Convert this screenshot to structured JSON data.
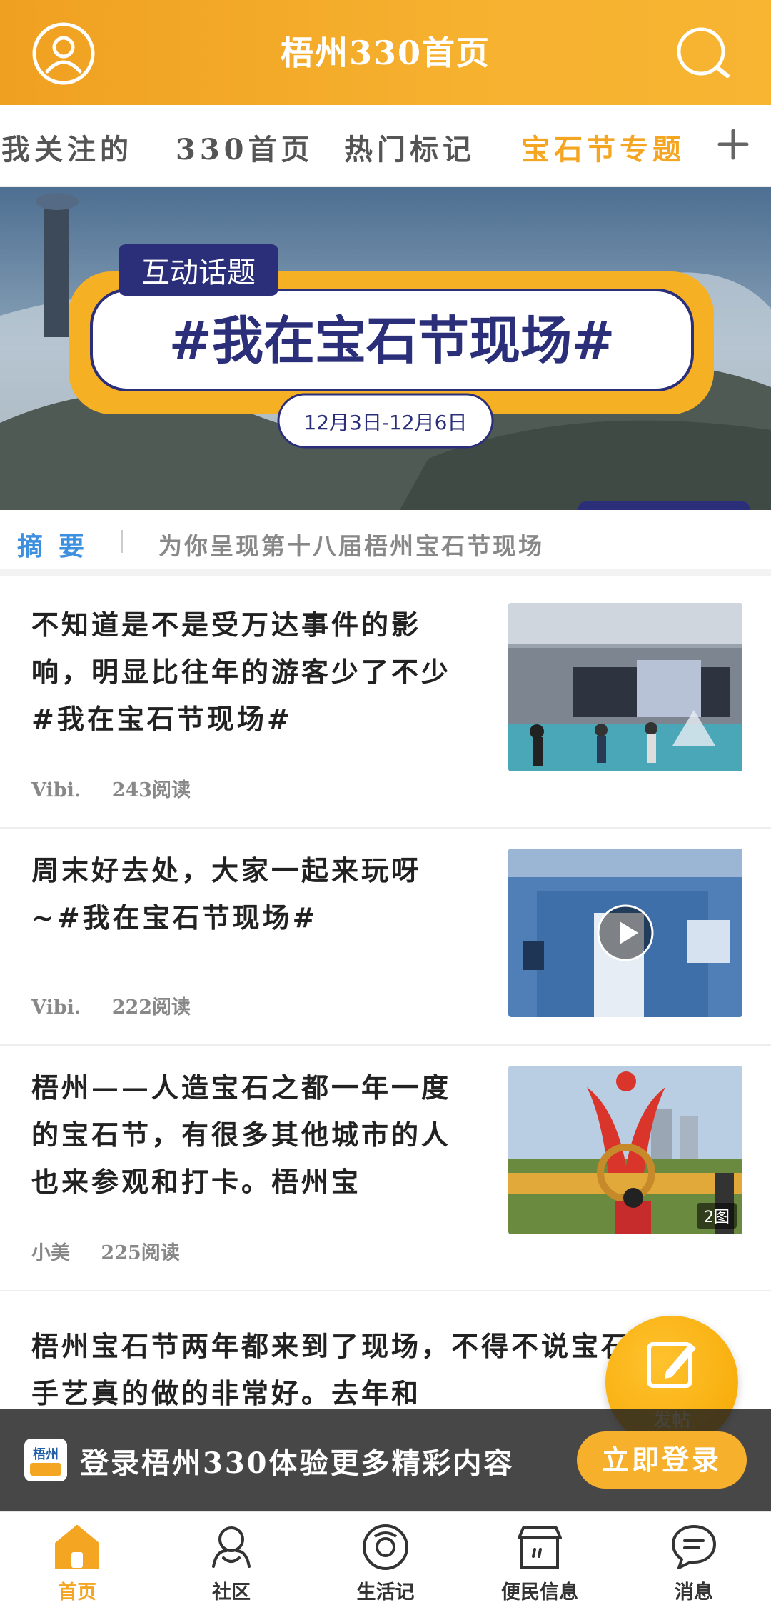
{
  "header": {
    "title": "梧州330首页"
  },
  "tabs": [
    {
      "label": "我关注的"
    },
    {
      "label": "330首页"
    },
    {
      "label": "热门标记"
    },
    {
      "label": "宝石节专题",
      "active": true
    }
  ],
  "banner": {
    "tag": "互动话题",
    "headline": "#我在宝石节现场#",
    "dates": "12月3日-12月6日"
  },
  "summary": {
    "label": "摘要",
    "text": "为你呈现第十八届梧州宝石节现场"
  },
  "feed": [
    {
      "title": "不知道是不是受万达事件的影响，明显比往年的游客少了不少#我在宝石节现场#",
      "author": "Vibi.",
      "reads": "243阅读",
      "media": "photo"
    },
    {
      "title": "周末好去处，大家一起来玩呀~#我在宝石节现场#",
      "author": "Vibi.",
      "reads": "222阅读",
      "media": "video"
    },
    {
      "title": "梧州——人造宝石之都一年一度的宝石节，有很多其他城市的人也来参观和打卡。梧州宝",
      "author": "小美",
      "reads": "225阅读",
      "media": "photo",
      "image_count": "2图"
    },
    {
      "title": "梧州宝石节两年都来到了现场，不得不说宝石文化和手艺真的做的非常好。去年和"
    }
  ],
  "fab": {
    "label": "发帖"
  },
  "login_bar": {
    "logo_text": "梧州",
    "text": "登录梧州330体验更多精彩内容",
    "button": "立即登录"
  },
  "bottom_nav": [
    {
      "label": "首页",
      "icon": "home-icon",
      "active": true
    },
    {
      "label": "社区",
      "icon": "community-icon"
    },
    {
      "label": "生活记",
      "icon": "life-icon"
    },
    {
      "label": "便民信息",
      "icon": "store-icon"
    },
    {
      "label": "消息",
      "icon": "message-icon"
    }
  ],
  "colors": {
    "accent": "#f4a623",
    "summary_label": "#3d8fe0",
    "banner_navy": "#2b2f7a"
  }
}
